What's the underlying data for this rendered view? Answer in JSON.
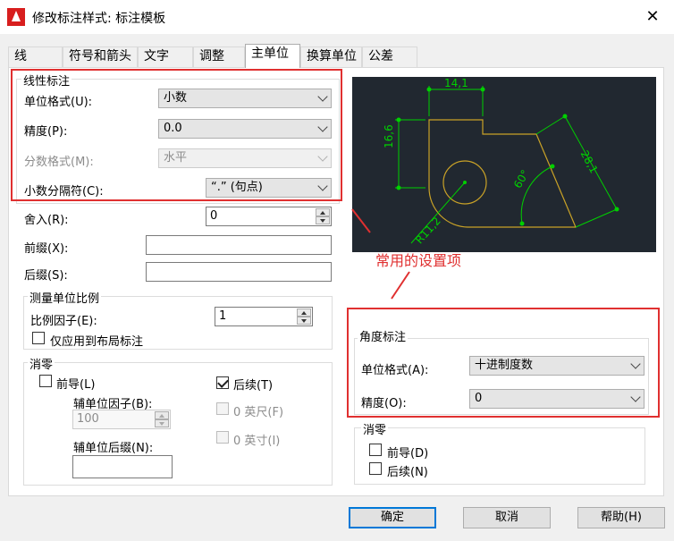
{
  "window": {
    "title": "修改标注样式: 标注模板",
    "close_symbol": "✕"
  },
  "tabs": [
    {
      "label": "线"
    },
    {
      "label": "符号和箭头"
    },
    {
      "label": "文字"
    },
    {
      "label": "调整"
    },
    {
      "label": "主单位"
    },
    {
      "label": "换算单位"
    },
    {
      "label": "公差"
    }
  ],
  "linear": {
    "title": "线性标注",
    "unit_format": {
      "label": "单位格式(U):",
      "value": "小数"
    },
    "precision": {
      "label": "精度(P):",
      "value": "0.0"
    },
    "fraction_format": {
      "label": "分数格式(M):",
      "value": "水平"
    },
    "decimal_separator": {
      "label": "小数分隔符(C):",
      "value": "“.” (句点)"
    },
    "round_off": {
      "label": "舍入(R):",
      "value": "0"
    },
    "prefix": {
      "label": "前缀(X):",
      "value": ""
    },
    "suffix": {
      "label": "后缀(S):",
      "value": ""
    }
  },
  "scale": {
    "title": "测量单位比例",
    "factor": {
      "label": "比例因子(E):",
      "value": "1"
    },
    "layout_only": {
      "label": "仅应用到布局标注",
      "checked": false
    }
  },
  "zero_linear": {
    "title": "消零",
    "leading": {
      "label": "前导(L)",
      "checked": false
    },
    "trailing": {
      "label": "后续(T)",
      "checked": true
    },
    "sub_unit_factor": {
      "label": "辅单位因子(B):",
      "value": "100"
    },
    "feet": {
      "label": "0 英尺(F)",
      "checked": false
    },
    "inches": {
      "label": "0 英寸(I)",
      "checked": false
    },
    "sub_unit_suffix": {
      "label": "辅单位后缀(N):",
      "value": ""
    }
  },
  "angular": {
    "title": "角度标注",
    "unit_format": {
      "label": "单位格式(A):",
      "value": "十进制度数"
    },
    "precision": {
      "label": "精度(O):",
      "value": "0"
    }
  },
  "zero_angular": {
    "title": "消零",
    "leading": {
      "label": "前导(D)",
      "checked": false
    },
    "trailing": {
      "label": "后续(N)",
      "checked": false
    }
  },
  "preview": {
    "dim_top": "14,1",
    "dim_left": "16,6",
    "dim_diag": "28,1",
    "dim_angle": "60°",
    "dim_radius": "R11,2"
  },
  "annotation": "常用的设置项",
  "buttons": {
    "ok": "确定",
    "cancel": "取消",
    "help": "帮助(H)"
  },
  "colors": {
    "highlight": "#e03030",
    "preview_bg": "#212830",
    "dim_green": "#00d000",
    "geometry_gold": "#c9a227"
  }
}
